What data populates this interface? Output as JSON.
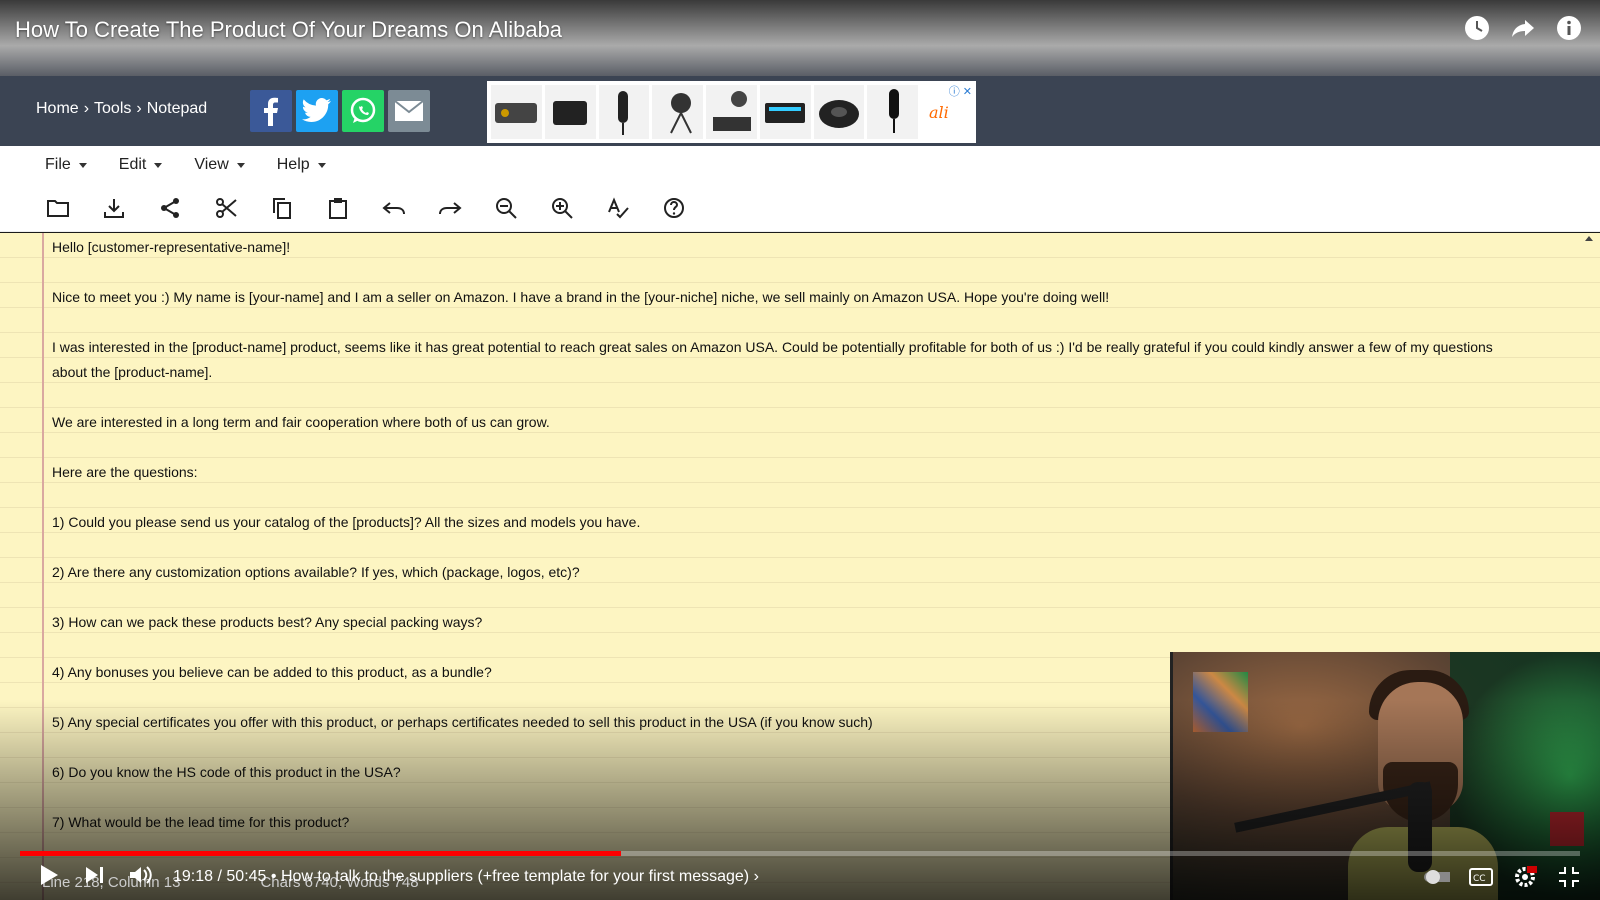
{
  "video": {
    "title": "How To Create The Product Of Your Dreams On Alibaba",
    "time_current": "19:18",
    "time_total": "50:45",
    "chapter": "How to talk to the suppliers (+free template for your first message)",
    "progress": 0.385,
    "icons": [
      "clock-icon",
      "share-arrow-icon",
      "info-icon"
    ]
  },
  "site": {
    "breadcrumb": [
      "Home",
      "Tools",
      "Notepad"
    ],
    "separator": "›",
    "share_buttons": [
      {
        "name": "facebook",
        "color": "#3b5998"
      },
      {
        "name": "twitter",
        "color": "#1da1f2"
      },
      {
        "name": "whatsapp",
        "color": "#25d366"
      },
      {
        "name": "email",
        "color": "#7c8b95"
      }
    ]
  },
  "menu": [
    "File",
    "Edit",
    "View",
    "Help"
  ],
  "notepad": {
    "lines": [
      "Hello [customer-representative-name]!",
      "",
      "Nice to meet you :) My name is [your-name] and I am a seller on Amazon. I have a brand in the [your-niche] niche, we sell mainly on Amazon USA. Hope you're doing well!",
      "",
      "I was interested in the [product-name] product, seems like it has great potential to reach great sales on Amazon USA. Could be potentially profitable for both of us :) I'd be really grateful if you could kindly answer a few of my questions",
      "about the [product-name].",
      "",
      "We are interested in a long term and fair cooperation where both of us can grow.",
      "",
      "Here are the questions:",
      "",
      "1) Could you please send us your catalog of the [products]? All the sizes and models you have.",
      "",
      "2) Are there any customization options available? If yes, which (package, logos, etc)?",
      "",
      "3) How can we pack these products best? Any special packing ways?",
      "",
      "4) Any bonuses you believe can be added to this product, as a bundle?",
      "",
      "5) Any special certificates you offer with this product, or perhaps certificates needed to sell this product in the USA (if you know such)",
      "",
      "6) Do you know the HS code of this product in the USA?",
      "",
      "7) What would be the lead time for this product?"
    ],
    "status_line": "Line 218, Column 13",
    "status_chars": "Chars 6740, Words 748"
  },
  "colors": {
    "progress": "#ff0000",
    "header": "#3b4453",
    "paper": "#fdf5c2"
  }
}
